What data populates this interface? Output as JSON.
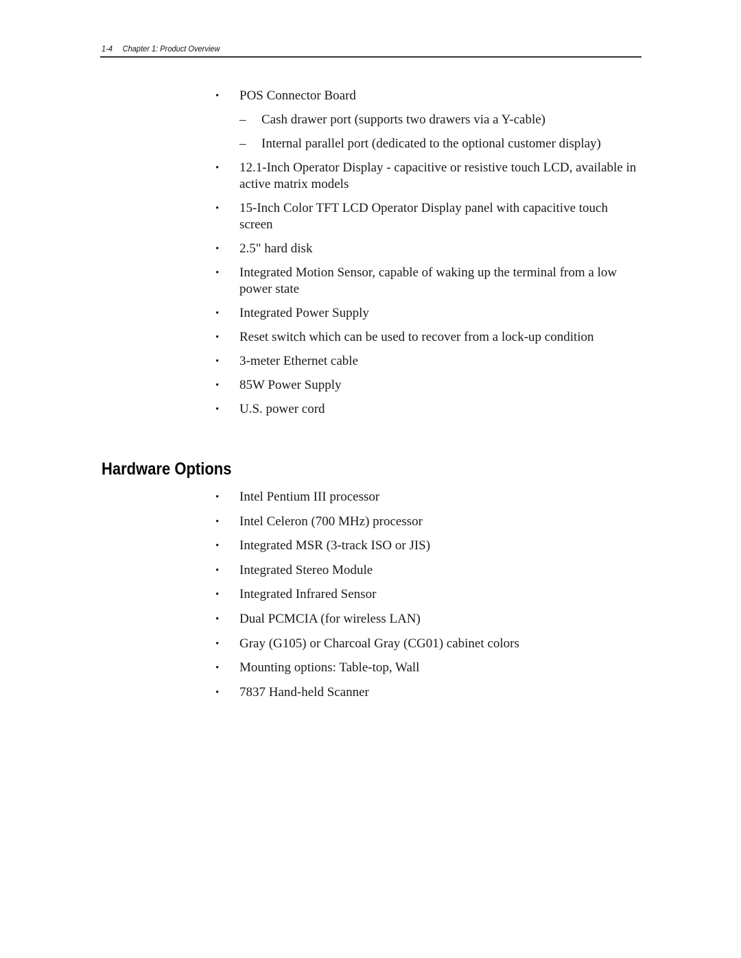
{
  "header": {
    "page_number": "1-4",
    "chapter_title": "Chapter 1: Product Overview"
  },
  "features": {
    "pos_connector_board": "POS Connector Board",
    "pos_sub_items": [
      "Cash drawer port (supports two drawers via a Y-cable)",
      "Internal parallel port (dedicated to the optional customer display)"
    ],
    "items": [
      "12.1-Inch Operator Display - capacitive or resistive touch LCD, available in active matrix models",
      "15-Inch Color TFT LCD Operator Display panel with capacitive touch screen",
      "2.5\" hard disk",
      "Integrated Motion Sensor, capable of waking up the terminal from a low power state",
      "Integrated Power Supply",
      "Reset switch which can be used to recover from a lock-up condition",
      "3-meter Ethernet cable",
      "85W Power Supply",
      "U.S. power cord"
    ]
  },
  "hardware_options": {
    "heading": "Hardware Options",
    "items": [
      "Intel Pentium III processor",
      "Intel Celeron (700 MHz) processor",
      "Integrated MSR (3-track ISO or JIS)",
      "Integrated Stereo Module",
      "Integrated Infrared Sensor",
      "Dual PCMCIA (for wireless LAN)",
      "Gray (G105) or Charcoal Gray (CG01) cabinet colors",
      "Mounting options: Table-top, Wall",
      "7837 Hand-held Scanner"
    ]
  },
  "symbols": {
    "bullet": "•",
    "dash": "–"
  }
}
